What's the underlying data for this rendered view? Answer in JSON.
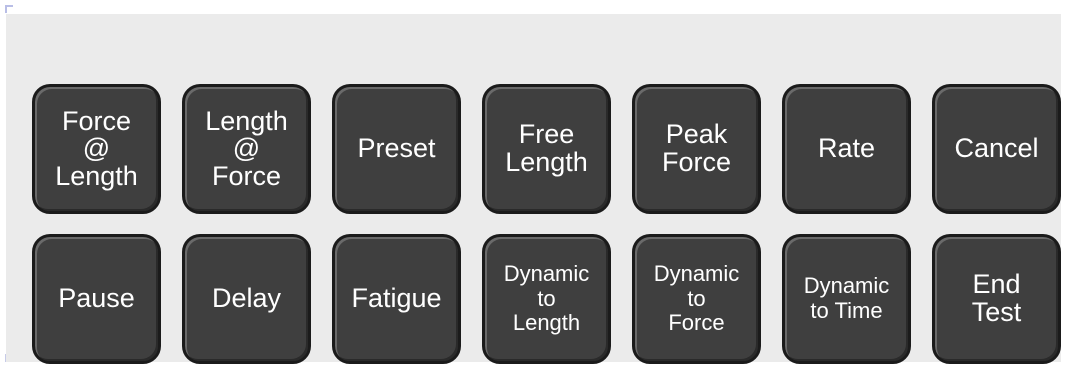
{
  "buttons": [
    {
      "label": "Force\n@\nLength",
      "name": "force-at-length-button"
    },
    {
      "label": "Length\n@\nForce",
      "name": "length-at-force-button"
    },
    {
      "label": "Preset",
      "name": "preset-button"
    },
    {
      "label": "Free\nLength",
      "name": "free-length-button"
    },
    {
      "label": "Peak\nForce",
      "name": "peak-force-button"
    },
    {
      "label": "Rate",
      "name": "rate-button"
    },
    {
      "label": "Cancel",
      "name": "cancel-button"
    },
    {
      "label": "Pause",
      "name": "pause-button"
    },
    {
      "label": "Delay",
      "name": "delay-button"
    },
    {
      "label": "Fatigue",
      "name": "fatigue-button"
    },
    {
      "label": "Dynamic\nto\nLength",
      "name": "dynamic-to-length-button"
    },
    {
      "label": "Dynamic\nto\nForce",
      "name": "dynamic-to-force-button"
    },
    {
      "label": "Dynamic\nto Time",
      "name": "dynamic-to-time-button"
    },
    {
      "label": "End\nTest",
      "name": "end-test-button"
    }
  ]
}
